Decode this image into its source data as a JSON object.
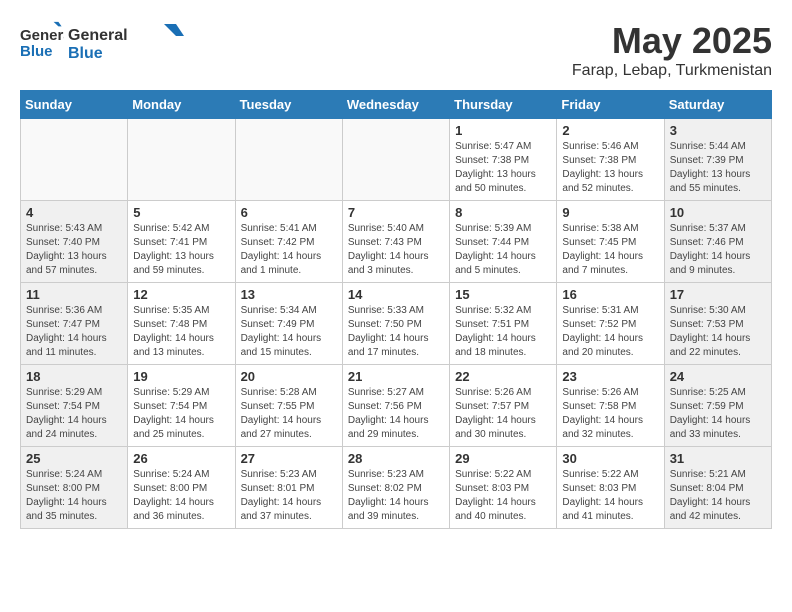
{
  "title": "May 2025",
  "location": "Farap, Lebap, Turkmenistan",
  "logo": {
    "general": "General",
    "blue": "Blue"
  },
  "headers": [
    "Sunday",
    "Monday",
    "Tuesday",
    "Wednesday",
    "Thursday",
    "Friday",
    "Saturday"
  ],
  "weeks": [
    [
      {
        "day": "",
        "info": ""
      },
      {
        "day": "",
        "info": ""
      },
      {
        "day": "",
        "info": ""
      },
      {
        "day": "",
        "info": ""
      },
      {
        "day": "1",
        "info": "Sunrise: 5:47 AM\nSunset: 7:38 PM\nDaylight: 13 hours\nand 50 minutes."
      },
      {
        "day": "2",
        "info": "Sunrise: 5:46 AM\nSunset: 7:38 PM\nDaylight: 13 hours\nand 52 minutes."
      },
      {
        "day": "3",
        "info": "Sunrise: 5:44 AM\nSunset: 7:39 PM\nDaylight: 13 hours\nand 55 minutes."
      }
    ],
    [
      {
        "day": "4",
        "info": "Sunrise: 5:43 AM\nSunset: 7:40 PM\nDaylight: 13 hours\nand 57 minutes."
      },
      {
        "day": "5",
        "info": "Sunrise: 5:42 AM\nSunset: 7:41 PM\nDaylight: 13 hours\nand 59 minutes."
      },
      {
        "day": "6",
        "info": "Sunrise: 5:41 AM\nSunset: 7:42 PM\nDaylight: 14 hours\nand 1 minute."
      },
      {
        "day": "7",
        "info": "Sunrise: 5:40 AM\nSunset: 7:43 PM\nDaylight: 14 hours\nand 3 minutes."
      },
      {
        "day": "8",
        "info": "Sunrise: 5:39 AM\nSunset: 7:44 PM\nDaylight: 14 hours\nand 5 minutes."
      },
      {
        "day": "9",
        "info": "Sunrise: 5:38 AM\nSunset: 7:45 PM\nDaylight: 14 hours\nand 7 minutes."
      },
      {
        "day": "10",
        "info": "Sunrise: 5:37 AM\nSunset: 7:46 PM\nDaylight: 14 hours\nand 9 minutes."
      }
    ],
    [
      {
        "day": "11",
        "info": "Sunrise: 5:36 AM\nSunset: 7:47 PM\nDaylight: 14 hours\nand 11 minutes."
      },
      {
        "day": "12",
        "info": "Sunrise: 5:35 AM\nSunset: 7:48 PM\nDaylight: 14 hours\nand 13 minutes."
      },
      {
        "day": "13",
        "info": "Sunrise: 5:34 AM\nSunset: 7:49 PM\nDaylight: 14 hours\nand 15 minutes."
      },
      {
        "day": "14",
        "info": "Sunrise: 5:33 AM\nSunset: 7:50 PM\nDaylight: 14 hours\nand 17 minutes."
      },
      {
        "day": "15",
        "info": "Sunrise: 5:32 AM\nSunset: 7:51 PM\nDaylight: 14 hours\nand 18 minutes."
      },
      {
        "day": "16",
        "info": "Sunrise: 5:31 AM\nSunset: 7:52 PM\nDaylight: 14 hours\nand 20 minutes."
      },
      {
        "day": "17",
        "info": "Sunrise: 5:30 AM\nSunset: 7:53 PM\nDaylight: 14 hours\nand 22 minutes."
      }
    ],
    [
      {
        "day": "18",
        "info": "Sunrise: 5:29 AM\nSunset: 7:54 PM\nDaylight: 14 hours\nand 24 minutes."
      },
      {
        "day": "19",
        "info": "Sunrise: 5:29 AM\nSunset: 7:54 PM\nDaylight: 14 hours\nand 25 minutes."
      },
      {
        "day": "20",
        "info": "Sunrise: 5:28 AM\nSunset: 7:55 PM\nDaylight: 14 hours\nand 27 minutes."
      },
      {
        "day": "21",
        "info": "Sunrise: 5:27 AM\nSunset: 7:56 PM\nDaylight: 14 hours\nand 29 minutes."
      },
      {
        "day": "22",
        "info": "Sunrise: 5:26 AM\nSunset: 7:57 PM\nDaylight: 14 hours\nand 30 minutes."
      },
      {
        "day": "23",
        "info": "Sunrise: 5:26 AM\nSunset: 7:58 PM\nDaylight: 14 hours\nand 32 minutes."
      },
      {
        "day": "24",
        "info": "Sunrise: 5:25 AM\nSunset: 7:59 PM\nDaylight: 14 hours\nand 33 minutes."
      }
    ],
    [
      {
        "day": "25",
        "info": "Sunrise: 5:24 AM\nSunset: 8:00 PM\nDaylight: 14 hours\nand 35 minutes."
      },
      {
        "day": "26",
        "info": "Sunrise: 5:24 AM\nSunset: 8:00 PM\nDaylight: 14 hours\nand 36 minutes."
      },
      {
        "day": "27",
        "info": "Sunrise: 5:23 AM\nSunset: 8:01 PM\nDaylight: 14 hours\nand 37 minutes."
      },
      {
        "day": "28",
        "info": "Sunrise: 5:23 AM\nSunset: 8:02 PM\nDaylight: 14 hours\nand 39 minutes."
      },
      {
        "day": "29",
        "info": "Sunrise: 5:22 AM\nSunset: 8:03 PM\nDaylight: 14 hours\nand 40 minutes."
      },
      {
        "day": "30",
        "info": "Sunrise: 5:22 AM\nSunset: 8:03 PM\nDaylight: 14 hours\nand 41 minutes."
      },
      {
        "day": "31",
        "info": "Sunrise: 5:21 AM\nSunset: 8:04 PM\nDaylight: 14 hours\nand 42 minutes."
      }
    ]
  ]
}
